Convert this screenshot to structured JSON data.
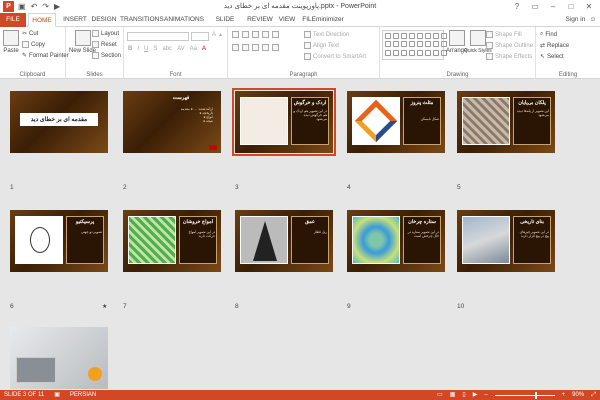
{
  "app": {
    "logo": "P",
    "title": "پاورپوینت مقدمه ای بر خطای دید.pptx - PowerPoint",
    "window_controls": [
      "?",
      "▭",
      "–",
      "□",
      "✕"
    ],
    "quick_access": [
      "save-icon",
      "undo-icon",
      "redo-icon",
      "start-from-beginning-icon"
    ]
  },
  "tabs": [
    "FILE",
    "HOME",
    "INSERT",
    "DESIGN",
    "TRANSITIONS",
    "ANIMATIONS",
    "SLIDE SHOW",
    "REVIEW",
    "VIEW",
    "FILEminimizer"
  ],
  "active_tab": "HOME",
  "signin_label": "Sign in",
  "ribbon": {
    "clipboard": {
      "label": "Clipboard",
      "paste": "Paste",
      "cut": "Cut",
      "copy": "Copy",
      "format_painter": "Format Painter"
    },
    "slides": {
      "label": "Slides",
      "new_slide": "New Slide",
      "layout": "Layout",
      "reset": "Reset",
      "section": "Section"
    },
    "font": {
      "label": "Font",
      "bold": "B",
      "italic": "I",
      "underline": "U",
      "strike": "S",
      "abc": "abc",
      "av": "AV",
      "aa": "Aa",
      "font_color": "A"
    },
    "paragraph": {
      "label": "Paragraph",
      "text_direction": "Text Direction",
      "align_text": "Align Text",
      "convert_smartart": "Convert to SmartArt"
    },
    "drawing": {
      "label": "Drawing",
      "arrange": "Arrange",
      "quick_styles": "Quick Styles",
      "shape_fill": "Shape Fill",
      "shape_outline": "Shape Outline",
      "shape_effects": "Shape Effects"
    },
    "editing": {
      "label": "Editing",
      "find": "Find",
      "replace": "Replace",
      "select": "Select"
    }
  },
  "slides": [
    {
      "number": "1",
      "title": "مقدمه ای بر خطای دید",
      "text": ""
    },
    {
      "number": "2",
      "title": "فهرست",
      "text": "ارائه‌دهنده: … ● مقدمه\n● تاریخچه\n● انواع\n● نتیجه"
    },
    {
      "number": "3",
      "title": "اردک و خرگوش",
      "text": "در این تصویر هم اردک و هم خرگوش دیده می‌شود"
    },
    {
      "number": "4",
      "title": "مثلث پنروز",
      "text": "شکل ناممکن"
    },
    {
      "number": "5",
      "title": "پلکان بی‌پایان",
      "text": "این تصویر از پله‌ها دیده می‌شود"
    },
    {
      "number": "6",
      "title": "پرسپکتیو",
      "text": "تصویر دو جهتی"
    },
    {
      "number": "7",
      "title": "امواج خروشان",
      "text": "در این تصویر امواج حرکت دارند"
    },
    {
      "number": "8",
      "title": "عمق",
      "text": "ریل قطار"
    },
    {
      "number": "9",
      "title": "ستاره چرخان",
      "text": "در این تصویر ستاره در حال چرخش است"
    },
    {
      "number": "10",
      "title": "بنای تاریخی",
      "text": "در این تصویر چیزهای پیچ در پیچ قرار دارند"
    },
    {
      "number": "11",
      "title": "",
      "text": ""
    }
  ],
  "slide6_star": "★",
  "status": {
    "slide_of": "SLIDE 3 OF 11",
    "language": "PERSIAN",
    "zoom": "90%",
    "zoom_fraction": 0.7
  }
}
